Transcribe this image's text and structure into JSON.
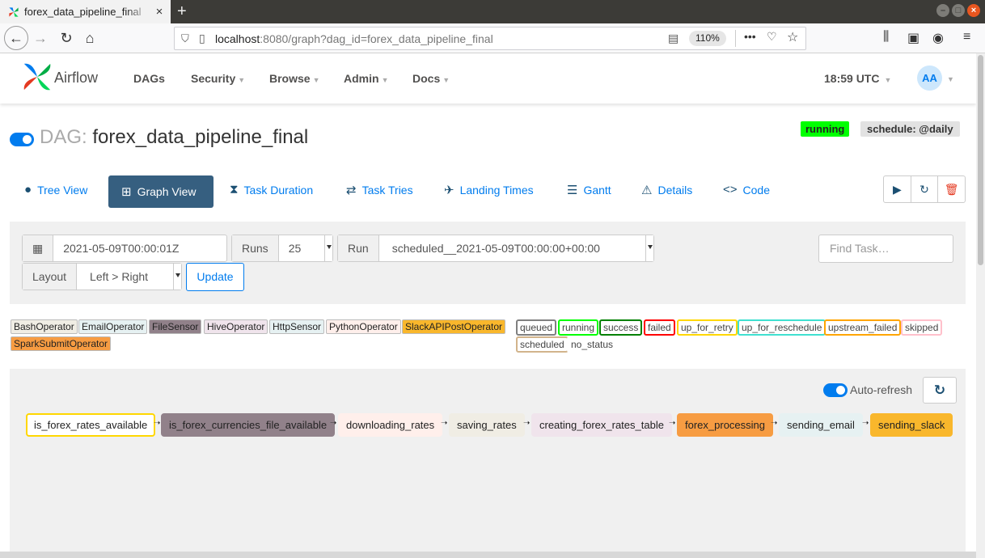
{
  "browser": {
    "tab_title": "forex_data_pipeline_final",
    "tab_close": "×",
    "new_tab": "+",
    "url_host": "localhost",
    "url_rest": ":8080/graph?dag_id=forex_data_pipeline_final",
    "zoom": "110%",
    "more": "•••"
  },
  "navbar": {
    "brand": "Airflow",
    "menu": [
      "DAGs",
      "Security",
      "Browse",
      "Admin",
      "Docs"
    ],
    "time": "18:59 UTC",
    "user_initials": "AA"
  },
  "dag": {
    "prefix": "DAG:",
    "name": "forex_data_pipeline_final",
    "state_badge": "running",
    "schedule_badge": "schedule: @daily"
  },
  "view_tabs": [
    {
      "label": "Tree View",
      "icon": "tree-icon"
    },
    {
      "label": "Graph View",
      "icon": "graph-icon"
    },
    {
      "label": "Task Duration",
      "icon": "hourglass-icon"
    },
    {
      "label": "Task Tries",
      "icon": "retry-icon"
    },
    {
      "label": "Landing Times",
      "icon": "landing-icon"
    },
    {
      "label": "Gantt",
      "icon": "gantt-icon"
    },
    {
      "label": "Details",
      "icon": "warning-icon"
    },
    {
      "label": "Code",
      "icon": "code-icon"
    }
  ],
  "filters": {
    "base_date": "2021-05-09T00:00:01Z",
    "runs_label": "Runs",
    "runs_value": "25",
    "run_label": "Run",
    "run_value": "scheduled__2021-05-09T00:00:00+00:00",
    "layout_label": "Layout",
    "layout_value": "Left > Right",
    "update_label": "Update",
    "find_task_placeholder": "Find Task…"
  },
  "operator_legend": [
    {
      "label": "BashOperator",
      "color": "#f0ede4"
    },
    {
      "label": "EmailOperator",
      "color": "#e6f1f2"
    },
    {
      "label": "FileSensor",
      "color": "#91818a"
    },
    {
      "label": "HiveOperator",
      "color": "#f0e4ec"
    },
    {
      "label": "HttpSensor",
      "color": "#e6f1f2"
    },
    {
      "label": "PythonOperator",
      "color": "#ffefeb"
    },
    {
      "label": "SlackAPIPostOperator",
      "color": "#f9b72c"
    },
    {
      "label": "SparkSubmitOperator",
      "color": "#f79c42"
    }
  ],
  "state_legend": [
    {
      "label": "queued",
      "color": "#808080"
    },
    {
      "label": "running",
      "color": "#00ff00"
    },
    {
      "label": "success",
      "color": "#008000"
    },
    {
      "label": "failed",
      "color": "#ff0000"
    },
    {
      "label": "up_for_retry",
      "color": "#ffd700"
    },
    {
      "label": "up_for_reschedule",
      "color": "#40e0d0"
    },
    {
      "label": "upstream_failed",
      "color": "#ffa500"
    },
    {
      "label": "skipped",
      "color": "#ffc0cb"
    },
    {
      "label": "scheduled",
      "color": "#d2b48c"
    },
    {
      "label": "no_status",
      "color": "#ffffff"
    }
  ],
  "graph": {
    "auto_refresh_label": "Auto-refresh",
    "tasks": [
      {
        "label": "is_forex_rates_available",
        "fill": "#ffffff",
        "border": "#ffd700"
      },
      {
        "label": "is_forex_currencies_file_available",
        "fill": "#91818a",
        "border": "#91818a"
      },
      {
        "label": "downloading_rates",
        "fill": "#ffefeb",
        "border": "#ffefeb"
      },
      {
        "label": "saving_rates",
        "fill": "#f0ede4",
        "border": "#f0ede4"
      },
      {
        "label": "creating_forex_rates_table",
        "fill": "#f0e4ec",
        "border": "#f0e4ec"
      },
      {
        "label": "forex_processing",
        "fill": "#f79c42",
        "border": "#f79c42"
      },
      {
        "label": "sending_email",
        "fill": "#e6f1f2",
        "border": "#e6f1f2"
      },
      {
        "label": "sending_slack",
        "fill": "#f9b72c",
        "border": "#f9b72c"
      }
    ]
  }
}
